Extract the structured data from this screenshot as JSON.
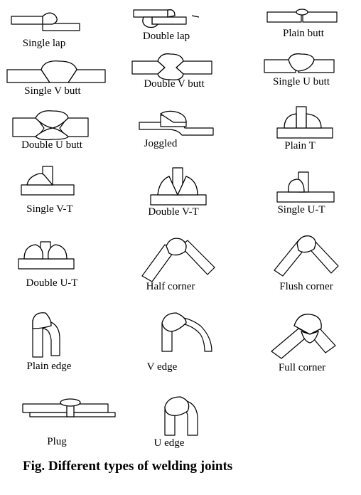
{
  "joints": [
    "Single lap",
    "Double lap",
    "Plain butt",
    "Single V butt",
    "Double V butt",
    "Single U butt",
    "Double U butt",
    "Joggled",
    "Plain T",
    "Single V-T",
    "Double V-T",
    "Single U-T",
    "Double U-T",
    "Half corner",
    "Flush corner",
    "Plain edge",
    "V edge",
    "Full corner",
    "Plug",
    "U edge"
  ],
  "caption": "Fig. Different types of welding joints"
}
